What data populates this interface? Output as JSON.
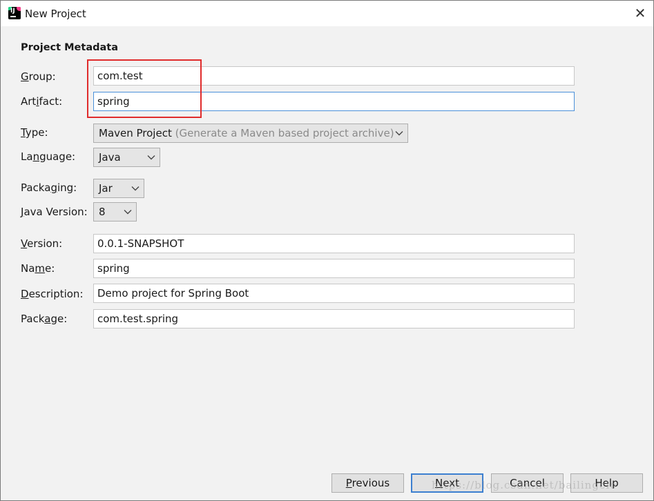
{
  "window": {
    "title": "New Project",
    "close_glyph": "✕"
  },
  "section": {
    "title": "Project Metadata"
  },
  "labels": {
    "group": [
      "",
      "G",
      "roup:"
    ],
    "artifact": [
      "Art",
      "i",
      "fact:"
    ],
    "type": [
      "",
      "T",
      "ype:"
    ],
    "language": [
      "La",
      "n",
      "guage:"
    ],
    "packaging": [
      "Packa",
      "g",
      "ing:"
    ],
    "java_version": [
      "",
      "J",
      "ava Version:"
    ],
    "version": [
      "",
      "V",
      "ersion:"
    ],
    "name": [
      "Na",
      "m",
      "e:"
    ],
    "description": [
      "",
      "D",
      "escription:"
    ],
    "package": [
      "Pack",
      "a",
      "ge:"
    ]
  },
  "fields": {
    "group": "com.test",
    "artifact": "spring",
    "version": "0.0.1-SNAPSHOT",
    "name": "spring",
    "description": "Demo project for Spring Boot",
    "package": "com.test.spring"
  },
  "combos": {
    "type": {
      "value": "Maven Project",
      "hint": "(Generate a Maven based project archive)"
    },
    "language": {
      "value": "Java"
    },
    "packaging": {
      "value": "Jar"
    },
    "java_version": {
      "value": "8"
    }
  },
  "buttons": {
    "previous": [
      "",
      "P",
      "revious"
    ],
    "next": [
      "",
      "N",
      "ext"
    ],
    "cancel": "Cancel",
    "help": "Help"
  },
  "watermark": "https://blog.csdn.net/bailingcio",
  "colors": {
    "highlight": "#e02b2b",
    "focus": "#4a90d9"
  },
  "icons": {
    "app": "intellij-idea-icon",
    "close": "close-icon",
    "dropdown": "chevron-down-icon"
  }
}
